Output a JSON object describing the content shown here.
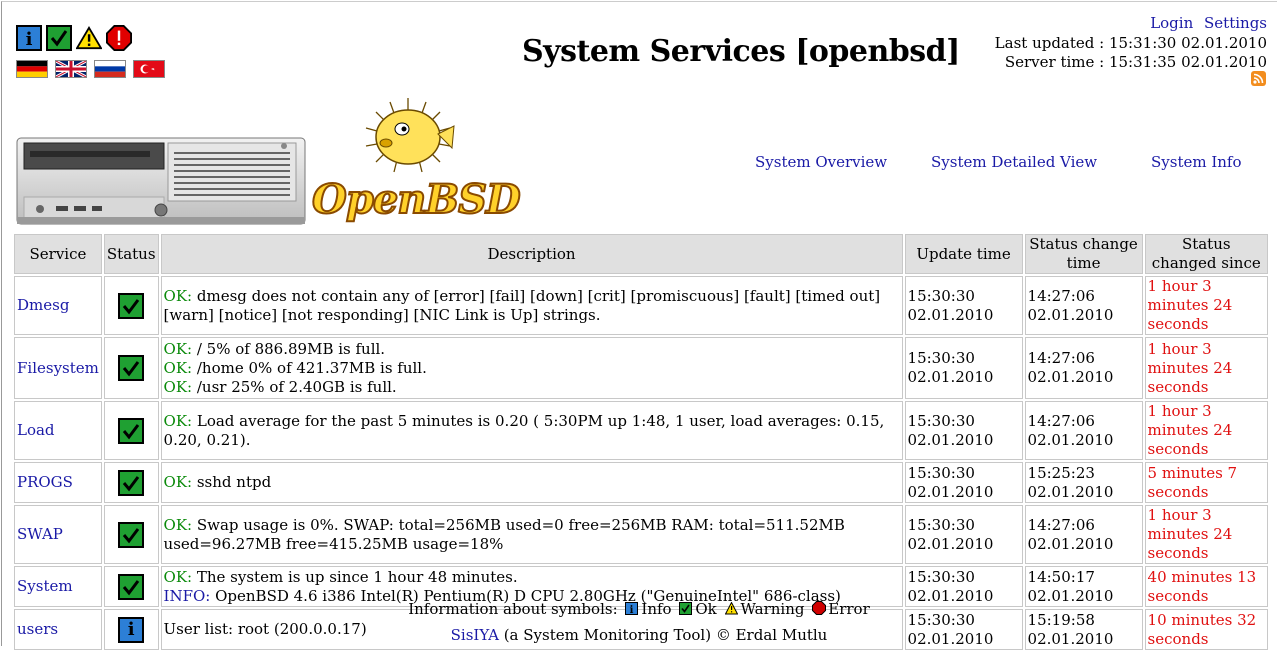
{
  "page": {
    "title": "System Services [openbsd]",
    "login": "Login",
    "settings": "Settings",
    "last_updated": "Last updated : 15:31:30 02.01.2010",
    "server_time": "Server time : 15:31:35 02.01.2010"
  },
  "symbols": [
    "info-icon",
    "ok-icon",
    "warning-icon",
    "error-icon"
  ],
  "flags": [
    "german-flag-icon",
    "uk-flag-icon",
    "russian-flag-icon",
    "turkish-flag-icon"
  ],
  "logo_text": "OpenBSD",
  "nav": {
    "overview": "System Overview",
    "detailed": "System Detailed View",
    "info": "System Info"
  },
  "table": {
    "headers": [
      "Service",
      "Status",
      "Description",
      "Update time",
      "Status change time",
      "Status changed since"
    ],
    "rows": [
      {
        "service": "Dmesg",
        "status": "ok",
        "desc": [
          {
            "tag": "OK:",
            "kind": "ok",
            "text": " dmesg does not contain any of [error] [fail] [down] [crit] [promiscuous] [fault] [timed out] [warn] [notice] [not responding] [NIC Link is Up] strings."
          }
        ],
        "update": [
          "15:30:30",
          "02.01.2010"
        ],
        "change": [
          "14:27:06",
          "02.01.2010"
        ],
        "since": "1 hour 3 minutes 24 seconds"
      },
      {
        "service": "Filesystem",
        "status": "ok",
        "desc": [
          {
            "tag": "OK:",
            "kind": "ok",
            "text": " / 5% of 886.89MB is full."
          },
          {
            "tag": "OK:",
            "kind": "ok",
            "text": " /home 0% of 421.37MB is full."
          },
          {
            "tag": "OK:",
            "kind": "ok",
            "text": " /usr 25% of 2.40GB is full."
          }
        ],
        "update": [
          "15:30:30",
          "02.01.2010"
        ],
        "change": [
          "14:27:06",
          "02.01.2010"
        ],
        "since": "1 hour 3 minutes 24 seconds"
      },
      {
        "service": "Load",
        "status": "ok",
        "desc": [
          {
            "tag": "OK:",
            "kind": "ok",
            "text": " Load average for the past 5 minutes is 0.20 ( 5:30PM up 1:48, 1 user, load averages: 0.15, 0.20, 0.21)."
          }
        ],
        "update": [
          "15:30:30",
          "02.01.2010"
        ],
        "change": [
          "14:27:06",
          "02.01.2010"
        ],
        "since": "1 hour 3 minutes 24 seconds"
      },
      {
        "service": "PROGS",
        "status": "ok",
        "desc": [
          {
            "tag": "OK:",
            "kind": "ok",
            "text": " sshd ntpd"
          }
        ],
        "update": [
          "15:30:30",
          "02.01.2010"
        ],
        "change": [
          "15:25:23",
          "02.01.2010"
        ],
        "since": "5 minutes 7 seconds"
      },
      {
        "service": "SWAP",
        "status": "ok",
        "desc": [
          {
            "tag": "OK:",
            "kind": "ok",
            "text": " Swap usage is 0%. SWAP: total=256MB used=0 free=256MB RAM: total=511.52MB used=96.27MB free=415.25MB usage=18%"
          }
        ],
        "update": [
          "15:30:30",
          "02.01.2010"
        ],
        "change": [
          "14:27:06",
          "02.01.2010"
        ],
        "since": "1 hour 3 minutes 24 seconds"
      },
      {
        "service": "System",
        "status": "ok",
        "desc": [
          {
            "tag": "OK:",
            "kind": "ok",
            "text": " The system is up since 1 hour 48 minutes."
          },
          {
            "tag": "INFO:",
            "kind": "info",
            "text": " OpenBSD 4.6 i386 Intel(R) Pentium(R) D CPU 2.80GHz (\"GenuineIntel\" 686-class)"
          }
        ],
        "update": [
          "15:30:30",
          "02.01.2010"
        ],
        "change": [
          "14:50:17",
          "02.01.2010"
        ],
        "since": "40 minutes 13 seconds"
      },
      {
        "service": "users",
        "status": "info",
        "desc": [
          {
            "tag": "",
            "kind": "plain",
            "text": "User list: root (200.0.0.17)"
          }
        ],
        "update": [
          "15:30:30",
          "02.01.2010"
        ],
        "change": [
          "15:19:58",
          "02.01.2010"
        ],
        "since": "10 minutes 32 seconds"
      }
    ]
  },
  "legend": {
    "prefix": "Information about symbols:",
    "info": "Info",
    "ok": "Ok",
    "warning": "Warning",
    "error": "Error"
  },
  "footer": {
    "link": "SisIYA",
    "text": " (a System Monitoring Tool) © Erdal Mutlu"
  },
  "colors": {
    "link": "#1a1aa6",
    "ok": "#0a8a0a",
    "since": "#e01010",
    "header_bg": "#e0e0e0"
  }
}
